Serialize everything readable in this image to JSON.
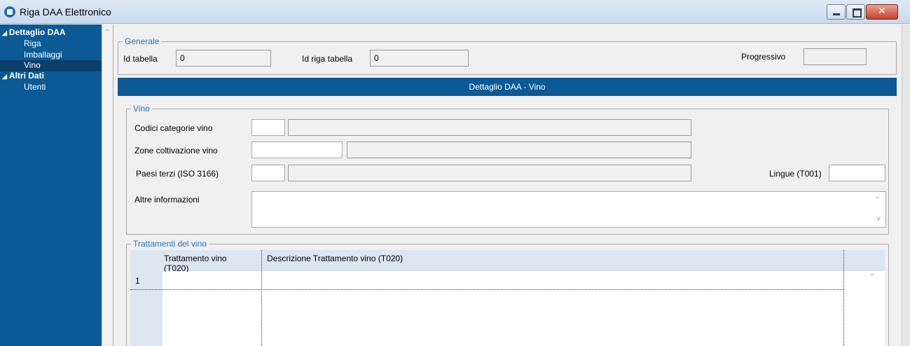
{
  "window": {
    "title": "Riga DAA Elettronico",
    "close_symbol": "✕"
  },
  "sidebar": {
    "items": [
      {
        "label": "Dettaglio DAA"
      },
      {
        "label": "Riga"
      },
      {
        "label": "Imballaggi"
      },
      {
        "label": "Vino"
      },
      {
        "label": "Altri Dati"
      },
      {
        "label": "Utenti"
      }
    ],
    "expand_symbol": "◢",
    "scroll_symbol": "^"
  },
  "generale": {
    "legend": "Generale",
    "id_tabella_label": "Id tabella",
    "id_tabella_value": "0",
    "id_riga_label": "Id riga tabella",
    "id_riga_value": "0",
    "progressivo_label": "Progressivo",
    "progressivo_value": ""
  },
  "header": {
    "title": "Dettaglio DAA - Vino"
  },
  "vino": {
    "legend": "Vino",
    "codici_label": "Codici categorie vino",
    "codici_code": "",
    "codici_desc": "",
    "zone_label": "Zone coltivazione vino",
    "zone_code": "",
    "zone_desc": "",
    "paesi_label": "Paesi terzi (ISO 3166)",
    "paesi_code": "",
    "paesi_desc": "",
    "lingue_label": "Lingue (T001)",
    "lingue_value": "",
    "altre_label": "Altre informazioni",
    "altre_value": "",
    "scroll_up": "^",
    "scroll_down": "v"
  },
  "trattamenti": {
    "legend": "Trattamenti del vino",
    "columns": [
      "Trattamento vino (T020)",
      "Descrizione Trattamento vino (T020)"
    ],
    "rows": [
      {
        "num": "1",
        "trattamento": "",
        "descrizione": ""
      }
    ],
    "scroll_up": "^"
  }
}
